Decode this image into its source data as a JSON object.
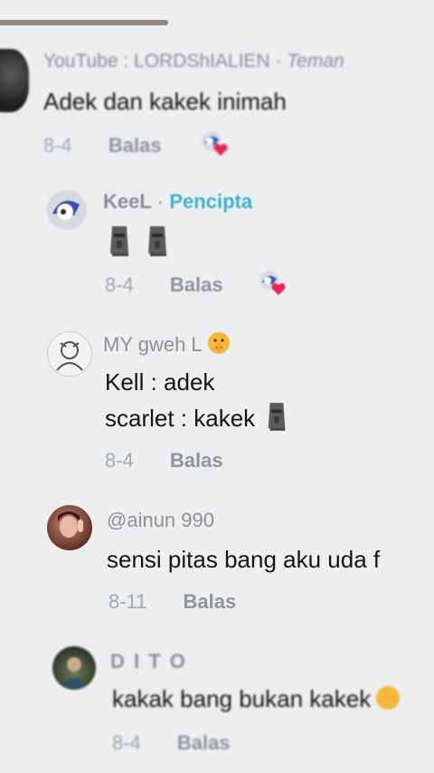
{
  "comments": [
    {
      "name": "YouTube : LORDShIALIEN",
      "suffix": "Teman",
      "text": "Adek dan kakek inimah",
      "date": "8-4",
      "reply": "Balas"
    },
    {
      "name": "KeeL",
      "badge": "Pencipta",
      "text": "",
      "date": "8-4",
      "reply": "Balas"
    },
    {
      "name": "MY gweh L",
      "text_line1": "Kell : adek",
      "text_line2": "scarlet : kakek",
      "date": "8-4",
      "reply": "Balas"
    },
    {
      "name": "@ainun 990",
      "text": "sensi pitas bang aku uda f",
      "date": "8-11",
      "reply": "Balas"
    },
    {
      "name": "D I T O",
      "text": "kakak bang bukan kakek",
      "date": "8-4",
      "reply": "Balas"
    }
  ],
  "separator": "·",
  "colors": {
    "creator": "#3bb5c9",
    "background": "#eceef0",
    "heart": "#e8264f"
  }
}
